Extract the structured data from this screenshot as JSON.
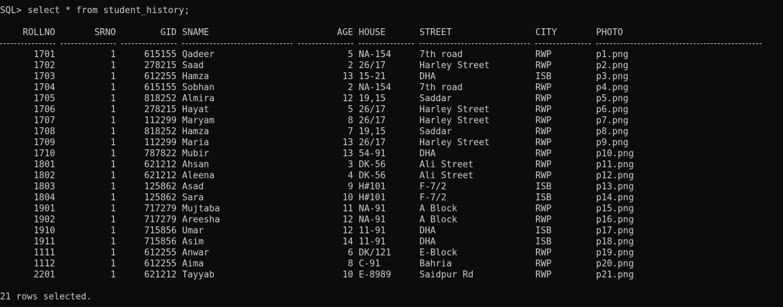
{
  "terminal": {
    "prompt": "SQL>",
    "command": "select * from student_history;",
    "footer": "21 rows selected."
  },
  "table": {
    "headers": [
      "ROLLNO",
      "SRNO",
      "GID",
      "SNAME",
      "AGE",
      "HOUSE",
      "STREET",
      "CITY",
      "PHOTO"
    ],
    "rows": [
      [
        "1701",
        "1",
        "615155",
        "Qadeer",
        "5",
        "NA-154",
        "7th road",
        "RWP",
        "p1.png"
      ],
      [
        "1702",
        "1",
        "278215",
        "Saad",
        "2",
        "26/17",
        "Harley Street",
        "RWP",
        "p2.png"
      ],
      [
        "1703",
        "1",
        "612255",
        "Hamza",
        "13",
        "15-21",
        "DHA",
        "ISB",
        "p3.png"
      ],
      [
        "1704",
        "1",
        "615155",
        "Sobhan",
        "2",
        "NA-154",
        "7th road",
        "RWP",
        "p4.png"
      ],
      [
        "1705",
        "1",
        "818252",
        "Almira",
        "12",
        "19,15",
        "Saddar",
        "RWP",
        "p5.png"
      ],
      [
        "1706",
        "1",
        "278215",
        "Hayat",
        "5",
        "26/17",
        "Harley Street",
        "RWP",
        "p6.png"
      ],
      [
        "1707",
        "1",
        "112299",
        "Maryam",
        "8",
        "26/17",
        "Harley Street",
        "RWP",
        "p7.png"
      ],
      [
        "1708",
        "1",
        "818252",
        "Hamza",
        "7",
        "19,15",
        "Saddar",
        "RWP",
        "p8.png"
      ],
      [
        "1709",
        "1",
        "112299",
        "Maria",
        "13",
        "26/17",
        "Harley Street",
        "RWP",
        "p9.png"
      ],
      [
        "1710",
        "1",
        "787822",
        "Mubir",
        "13",
        "54-91",
        "DHA",
        "RWP",
        "p10.png"
      ],
      [
        "1801",
        "1",
        "621212",
        "Ahsan",
        "3",
        "DK-56",
        "Ali Street",
        "RWP",
        "p11.png"
      ],
      [
        "1802",
        "1",
        "621212",
        "Aleena",
        "4",
        "DK-56",
        "Ali Street",
        "RWP",
        "p12.png"
      ],
      [
        "1803",
        "1",
        "125862",
        "Asad",
        "9",
        "H#101",
        "F-7/2",
        "ISB",
        "p13.png"
      ],
      [
        "1804",
        "1",
        "125862",
        "Sara",
        "10",
        "H#101",
        "F-7/2",
        "ISB",
        "p14.png"
      ],
      [
        "1901",
        "1",
        "717279",
        "Mujtaba",
        "11",
        "NA-91",
        "A Block",
        "RWP",
        "p15.png"
      ],
      [
        "1902",
        "1",
        "717279",
        "Areesha",
        "12",
        "NA-91",
        "A Block",
        "RWP",
        "p16.png"
      ],
      [
        "1910",
        "1",
        "715856",
        "Umar",
        "12",
        "11-91",
        "DHA",
        "ISB",
        "p17.png"
      ],
      [
        "1911",
        "1",
        "715856",
        "Asim",
        "14",
        "11-91",
        "DHA",
        "ISB",
        "p18.png"
      ],
      [
        "1111",
        "1",
        "612255",
        "Anwar",
        "6",
        "DK/121",
        "E-Block",
        "RWP",
        "p19.png"
      ],
      [
        "1112",
        "1",
        "612255",
        "Aima",
        "8",
        "C-91",
        "Bahria",
        "RWP",
        "p20.png"
      ],
      [
        "2201",
        "1",
        "621212",
        "Tayyab",
        "10",
        "E-8989",
        "Saidpur Rd",
        "RWP",
        "p21.png"
      ]
    ]
  }
}
